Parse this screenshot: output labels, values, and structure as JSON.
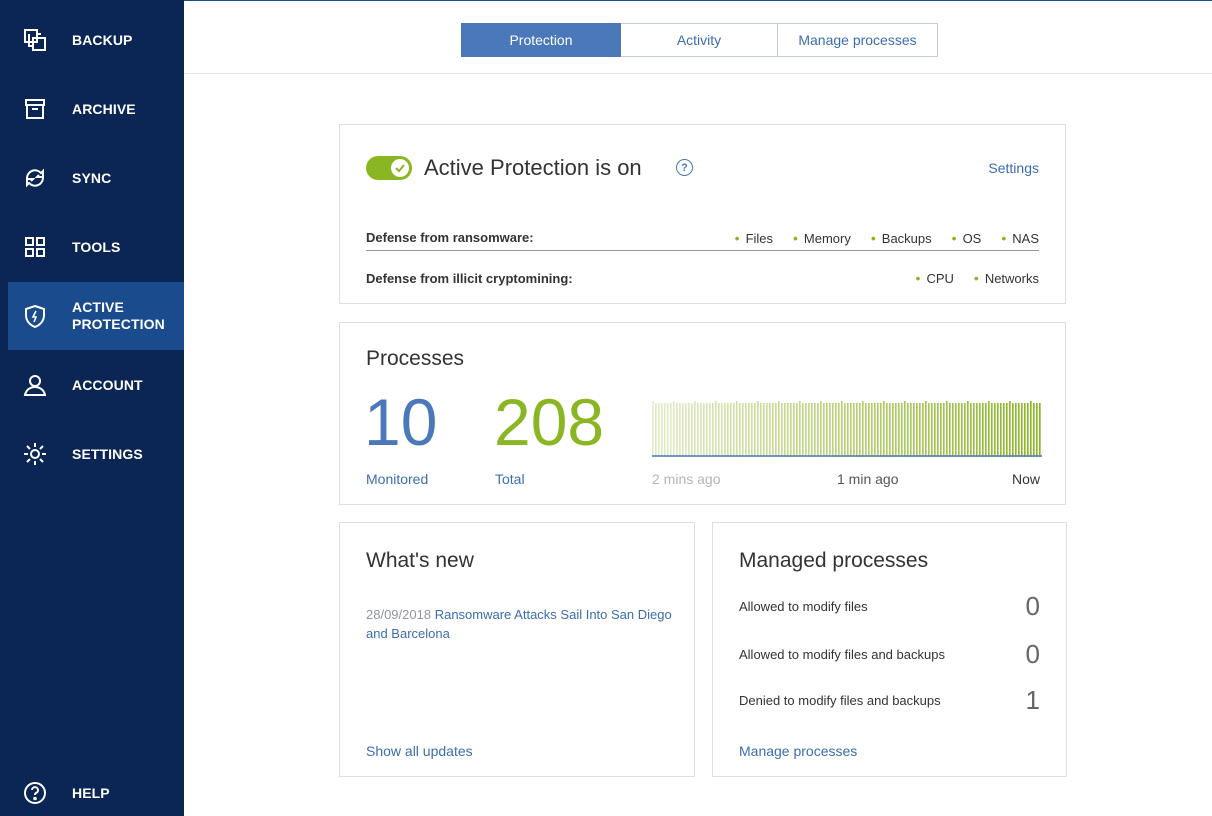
{
  "sidebar": {
    "items": [
      {
        "label": "BACKUP",
        "icon": "backup-icon"
      },
      {
        "label": "ARCHIVE",
        "icon": "archive-icon"
      },
      {
        "label": "SYNC",
        "icon": "sync-icon"
      },
      {
        "label": "TOOLS",
        "icon": "tools-icon"
      },
      {
        "label": "ACTIVE\nPROTECTION",
        "icon": "shield-icon",
        "active": true
      },
      {
        "label": "ACCOUNT",
        "icon": "user-icon"
      },
      {
        "label": "SETTINGS",
        "icon": "gear-icon"
      }
    ],
    "help_label": "HELP"
  },
  "tabs": [
    {
      "label": "Protection",
      "selected": true
    },
    {
      "label": "Activity",
      "selected": false
    },
    {
      "label": "Manage processes",
      "selected": false
    }
  ],
  "active_protection": {
    "title": "Active Protection is on",
    "help": "?",
    "settings_link": "Settings",
    "toggle_on": true,
    "ransomware": {
      "label": "Defense from ransomware:",
      "items": [
        "Files",
        "Memory",
        "Backups",
        "OS",
        "NAS"
      ]
    },
    "cryptomining": {
      "label": "Defense from illicit cryptomining:",
      "items": [
        "CPU",
        "Networks"
      ]
    }
  },
  "processes": {
    "title": "Processes",
    "monitored_count": "10",
    "monitored_label": "Monitored",
    "total_count": "208",
    "total_label": "Total",
    "timeline": {
      "start": "2 mins ago",
      "mid": "1 min ago",
      "end": "Now"
    }
  },
  "whats_new": {
    "title": "What's new",
    "date": "28/09/2018",
    "headline": "Ransomware Attacks Sail Into San Diego and Barcelona",
    "show_all": "Show all updates"
  },
  "managed": {
    "title": "Managed processes",
    "rows": [
      {
        "label": "Allowed to modify files",
        "value": "0"
      },
      {
        "label": "Allowed to modify files and backups",
        "value": "0"
      },
      {
        "label": "Denied to modify files and backups",
        "value": "1"
      }
    ],
    "link": "Manage processes"
  },
  "colors": {
    "sidebar_bg": "#0b2654",
    "sidebar_active": "#1a4b8c",
    "accent_blue": "#4a78b8",
    "accent_green": "#8ab624"
  }
}
